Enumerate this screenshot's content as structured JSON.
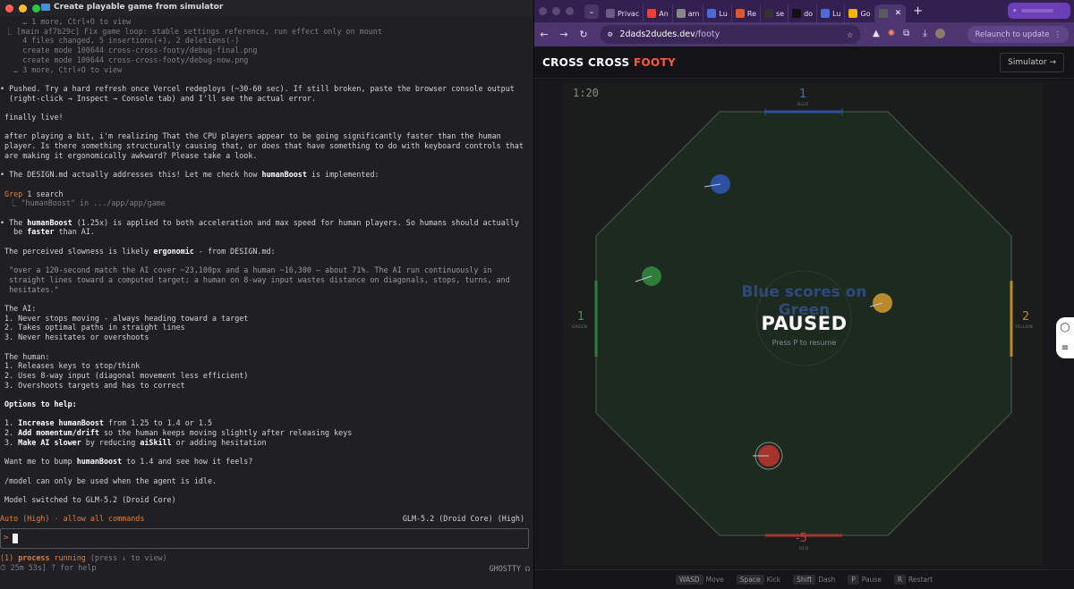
{
  "terminal": {
    "title": "Create playable game from simulator",
    "lines": [
      {
        "text": "     … 1 more, Ctrl+O to view",
        "style": "dim"
      },
      {
        "text": " ⎿ [main af7b29c] Fix game loop: stable settings reference, run effect only on mount",
        "style": "dim"
      },
      {
        "text": "     4 files changed, 5 insertions(+), 2 deletions(-)",
        "style": "dim"
      },
      {
        "text": "     create mode 100644 cross-cross-footy/debug-final.png",
        "style": "dim"
      },
      {
        "text": "     create mode 100644 cross-cross-footy/debug-now.png",
        "style": "dim"
      },
      {
        "text": "   … 3 more, Ctrl+O to view",
        "style": "dim"
      },
      {
        "text": "",
        "style": ""
      },
      {
        "text": "• Pushed. Try a hard refresh once Vercel redeploys (~30-60 sec). If still broken, paste the browser console output",
        "style": ""
      },
      {
        "text": "  (right-click → Inspect → Console tab) and I'll see the actual error.",
        "style": ""
      },
      {
        "text": "",
        "style": ""
      },
      {
        "text": " finally live!",
        "style": ""
      },
      {
        "text": "",
        "style": ""
      },
      {
        "text": " after playing a bit, i'm realizing That the CPU players appear to be going significantly faster than the human",
        "style": ""
      },
      {
        "text": " player. Is there something structurally causing that, or does that have something to do with keyboard controls that",
        "style": ""
      },
      {
        "text": " are making it ergonomically awkward? Please take a look.",
        "style": ""
      },
      {
        "text": "",
        "style": ""
      },
      {
        "text": "• The DESIGN.md actually addresses this! Let me check how humanBoost is implemented:",
        "style": "rich1"
      },
      {
        "text": "",
        "style": ""
      },
      {
        "text": " Grep 1 search",
        "style": "grep"
      },
      {
        "text": "  ⎿ \"humanBoost\" in .../app/app/game",
        "style": "dim"
      },
      {
        "text": "",
        "style": ""
      },
      {
        "text": "• The humanBoost (1.25x) is applied to both acceleration and max speed for human players. So humans should actually",
        "style": "rich2"
      },
      {
        "text": "   be faster than AI.",
        "style": "rich3"
      },
      {
        "text": "",
        "style": ""
      },
      {
        "text": " The perceived slowness is likely ergonomic - from DESIGN.md:",
        "style": "rich4"
      },
      {
        "text": "",
        "style": ""
      },
      {
        "text": "  \"over a 120-second match the AI cover ~23,100px and a human ~16,300 — about 71%. The AI run continuously in",
        "style": "gray"
      },
      {
        "text": "  straight lines toward a computed target; a human on 8-way input wastes distance on diagonals, stops, turns, and",
        "style": "gray"
      },
      {
        "text": "  hesitates.\"",
        "style": "gray"
      },
      {
        "text": "",
        "style": ""
      },
      {
        "text": " The AI:",
        "style": ""
      },
      {
        "text": " 1. Never stops moving - always heading toward a target",
        "style": ""
      },
      {
        "text": " 2. Takes optimal paths in straight lines",
        "style": ""
      },
      {
        "text": " 3. Never hesitates or overshoots",
        "style": ""
      },
      {
        "text": "",
        "style": ""
      },
      {
        "text": " The human:",
        "style": ""
      },
      {
        "text": " 1. Releases keys to stop/think",
        "style": ""
      },
      {
        "text": " 2. Uses 8-way input (diagonal movement less efficient)",
        "style": ""
      },
      {
        "text": " 3. Overshoots targets and has to correct",
        "style": ""
      },
      {
        "text": "",
        "style": ""
      },
      {
        "text": " Options to help:",
        "style": "boldline"
      },
      {
        "text": "",
        "style": ""
      },
      {
        "text": " 1. Increase humanBoost from 1.25 to 1.4 or 1.5",
        "style": "opt1"
      },
      {
        "text": " 2. Add momentum/drift so the human keeps moving slightly after releasing keys",
        "style": "opt2"
      },
      {
        "text": " 3. Make AI slower by reducing aiSkill or adding hesitation",
        "style": "opt3"
      },
      {
        "text": "",
        "style": ""
      },
      {
        "text": " Want me to bump humanBoost to 1.4 and see how it feels?",
        "style": "rich5"
      },
      {
        "text": "",
        "style": ""
      },
      {
        "text": " /model can only be used when the agent is idle.",
        "style": ""
      },
      {
        "text": "",
        "style": ""
      },
      {
        "text": " Model switched to GLM-5.2 (Droid Core)",
        "style": ""
      }
    ],
    "mode_text": "Auto (High)",
    "mode_sep": " · ",
    "mode_perm": "allow all commands",
    "model_label": "GLM-5.2 (Droid Core) (High)",
    "prompt_char": ">",
    "process_count": "(1)",
    "process_word": "process",
    "process_state": "running",
    "process_hint": "(press ↓ to view)",
    "elapsed": "⏱ 25m 53s]",
    "help_hint": "? for help",
    "terminal_name": "GHOSTTY ☊"
  },
  "browser": {
    "tabs": [
      {
        "label": "Privac",
        "icon": "privacy-icon",
        "color": "#6b5b8a"
      },
      {
        "label": "An",
        "icon": "gmail-icon",
        "color": "#ea4335"
      },
      {
        "label": "am",
        "icon": "globe-icon",
        "color": "#888888"
      },
      {
        "label": "Lu",
        "icon": "linear-icon",
        "color": "#4b6bd6"
      },
      {
        "label": "Re",
        "icon": "reddit-icon",
        "color": "#e0562a"
      },
      {
        "label": "se",
        "icon": "openai-icon",
        "color": "#333333"
      },
      {
        "label": "do",
        "icon": "vercel-icon",
        "color": "#111111"
      },
      {
        "label": "Lu",
        "icon": "linear-icon",
        "color": "#4b6bd6"
      },
      {
        "label": "Go",
        "icon": "meet-icon",
        "color": "#f4b400"
      },
      {
        "label": "",
        "icon": "game-icon",
        "color": "#5a5a5a",
        "active": true
      }
    ],
    "url_domain": "2dads2dudes.dev",
    "url_path": "/footy",
    "relaunch_label": "Relaunch to update",
    "relaunch_icon": "⋮"
  },
  "game": {
    "logo_part1": "CROSS CROSS",
    "logo_part2": "FOOTY",
    "simulator_button": "Simulator →",
    "timer": "1:20",
    "scores": {
      "top": "1",
      "left": "1",
      "right": "2",
      "bottom": "-5"
    },
    "team_labels": {
      "top": "BLUE",
      "left": "GREEN",
      "right": "YELLOW",
      "bottom": "RED"
    },
    "event_text": "Blue scores on Green",
    "paused_title": "PAUSED",
    "paused_hint": "Press P to resume",
    "colors": {
      "blue": "#2c4f9e",
      "green": "#2e7d3a",
      "yellow": "#b88a2a",
      "red": "#a8322c",
      "field": "#1e2a20"
    },
    "controls": [
      {
        "key": "WASD",
        "action": "Move"
      },
      {
        "key": "Space",
        "action": "Kick"
      },
      {
        "key": "Shift",
        "action": "Dash"
      },
      {
        "key": "P",
        "action": "Pause"
      },
      {
        "key": "R",
        "action": "Restart"
      }
    ]
  }
}
